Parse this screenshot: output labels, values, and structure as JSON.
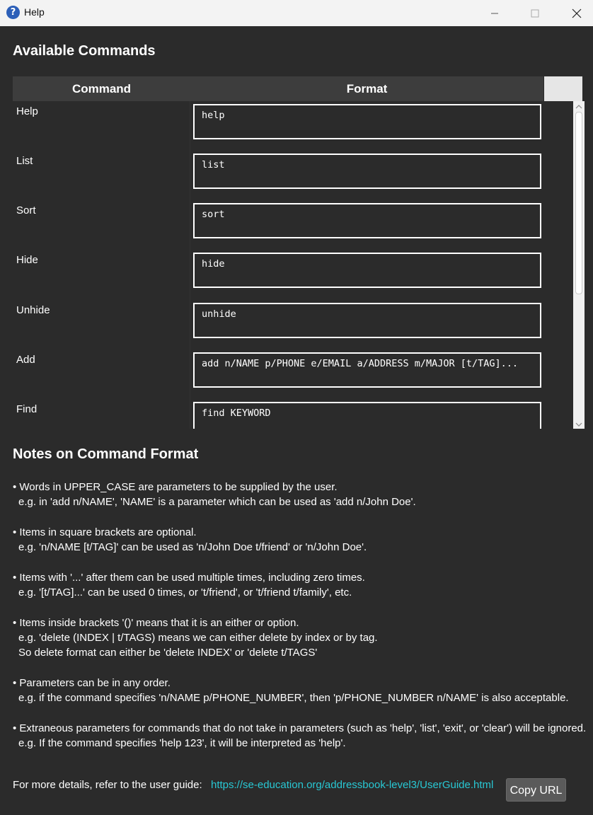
{
  "window": {
    "title": "Help",
    "app_icon": "help-question-icon",
    "app_icon_glyph": "?"
  },
  "commands_section": {
    "heading": "Available Commands",
    "columns": [
      "Command",
      "Format"
    ],
    "rows": [
      {
        "command": "Help",
        "format": "help"
      },
      {
        "command": "List",
        "format": "list"
      },
      {
        "command": "Sort",
        "format": "sort"
      },
      {
        "command": "Hide",
        "format": "hide"
      },
      {
        "command": "Unhide",
        "format": "unhide"
      },
      {
        "command": "Add",
        "format": "add n/NAME p/PHONE e/EMAIL a/ADDRESS m/MAJOR [t/TAG]..."
      },
      {
        "command": "Find",
        "format": "find KEYWORD"
      }
    ]
  },
  "notes_section": {
    "heading": "Notes on Command Format",
    "notes": [
      {
        "lines": [
          "• Words in UPPER_CASE are parameters to be supplied by the user.",
          "e.g. in 'add n/NAME', 'NAME' is a parameter which can be used as 'add n/John Doe'."
        ]
      },
      {
        "lines": [
          "• Items in square brackets are optional.",
          "e.g. 'n/NAME [t/TAG]' can be used as 'n/John Doe t/friend' or 'n/John Doe'."
        ]
      },
      {
        "lines": [
          "• Items with '...' after them can be used multiple times, including zero times.",
          "e.g. '[t/TAG]...' can be used 0 times, or 't/friend', or 't/friend t/family', etc."
        ]
      },
      {
        "lines": [
          "• Items inside brackets '()' means that it is an either or option.",
          "e.g. 'delete (INDEX | t/TAGS) means we can either delete by index or by tag.",
          "So delete format can either be 'delete INDEX' or 'delete t/TAGS'"
        ]
      },
      {
        "lines": [
          "• Parameters can be in any order.",
          "e.g. if the command specifies 'n/NAME p/PHONE_NUMBER', then 'p/PHONE_NUMBER n/NAME' is also acceptable."
        ]
      },
      {
        "lines": [
          "• Extraneous parameters for commands that do not take in parameters (such as 'help', 'list', 'exit', or 'clear') will be ignored.",
          "e.g. If the command specifies 'help 123', it will be interpreted as 'help'."
        ]
      }
    ]
  },
  "footer": {
    "text": "For more details, refer to the user guide:",
    "link": "https://se-education.org/addressbook-level3/UserGuide.html",
    "copy_button": "Copy URL"
  },
  "colors": {
    "background": "#2b2b2b",
    "header_bg": "#3d3d3d",
    "link": "#28c8d4",
    "button_bg": "#5a5a5a"
  }
}
